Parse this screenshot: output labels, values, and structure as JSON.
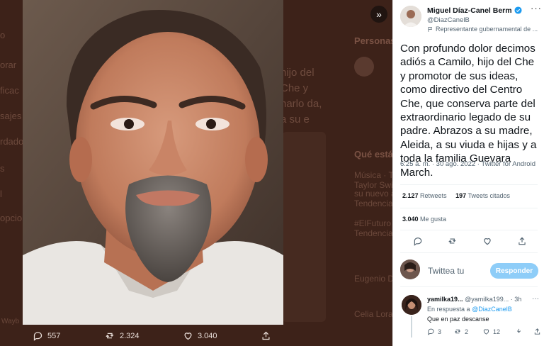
{
  "background": {
    "nav_items": [
      "o",
      "orar",
      "ficac",
      "sajes",
      "rdados",
      "s",
      "l",
      "opcio"
    ],
    "tweet_snippet": "hijo del Che y narlo da, a su e",
    "panel_heading": "Personas",
    "trends_heading": "Qué está",
    "trend_lines": [
      "Música · Tendencia",
      "Taylor Swift",
      "su nuevo álbum",
      "Tendencias",
      "#ElFuturo",
      "Tendencia",
      "Eugenio Derbez",
      "Celia Lora"
    ],
    "bottom_label": "Wayb"
  },
  "photo_actions": {
    "replies": "557",
    "retweets": "2.324",
    "likes": "3.040"
  },
  "tweet": {
    "author_name": "Miguel Díaz-Canel Bermú...",
    "handle": "@DiazCanelB",
    "gov_label": "Representante gubernamental de ...",
    "text": "Con profundo dolor decimos adiós a Camilo, hijo del Che y promotor de sus ideas, como directivo del Centro Che, que conserva parte del extraordinario legado de su padre. Abrazos a su madre, Aleida, a su viuda e hijas y a toda la familia Guevara March.",
    "meta": "6:25 a. m. · 30 ago. 2022 · Twitter for Android",
    "retweets_count": "2.127",
    "retweets_label": "Retweets",
    "quotes_count": "197",
    "quotes_label": "Tweets citados",
    "likes_count": "3.040",
    "likes_label": "Me gusta"
  },
  "reply_box": {
    "placeholder": "Twittea tu",
    "button": "Responder"
  },
  "comment": {
    "name": "yamilka19...",
    "handle": "@yamilka199...",
    "time": "· 3h",
    "reply_to_prefix": "En respuesta a",
    "reply_to_handle": "@DiazCanelB",
    "text": "Que en paz descanse",
    "replies": "3",
    "retweets": "2",
    "likes": "12"
  },
  "colors": {
    "accent": "#1d9bf0",
    "reply_button": "#8ecdf8",
    "overlay": "#3d2219"
  }
}
